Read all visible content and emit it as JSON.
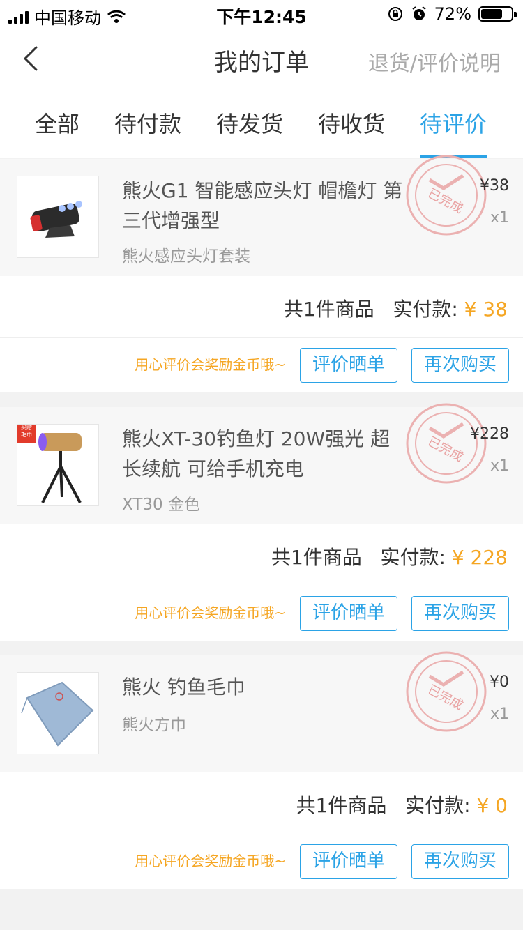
{
  "status_bar": {
    "carrier": "中国移动",
    "time": "下午12:45",
    "battery_pct": "72%",
    "battery_level": 0.72,
    "icons": [
      "signal-icon",
      "wifi-icon",
      "rotation-lock-icon",
      "alarm-icon",
      "battery-icon"
    ]
  },
  "nav": {
    "title": "我的订单",
    "right_link": "退货/评价说明",
    "back_icon": "chevron-left-icon"
  },
  "tabs": [
    {
      "label": "全部",
      "active": false
    },
    {
      "label": "待付款",
      "active": false
    },
    {
      "label": "待发货",
      "active": false
    },
    {
      "label": "待收货",
      "active": false
    },
    {
      "label": "待评价",
      "active": true
    }
  ],
  "stamp_text": "已完成",
  "orders": [
    {
      "name": "熊火G1 智能感应头灯 帽檐灯 第三代增强型",
      "spec": "熊火感应头灯套装",
      "price": "¥38",
      "qty": "x1",
      "count_text": "共1件商品",
      "paid_label": "实付款:",
      "paid_amount": "¥ 38",
      "tip": "用心评价会奖励金币哦~",
      "btn_review": "评价晒单",
      "btn_rebuy": "再次购买"
    },
    {
      "name": "熊火XT-30钓鱼灯 20W强光 超长续航 可给手机充电",
      "spec": "XT30 金色",
      "price": "¥228",
      "qty": "x1",
      "count_text": "共1件商品",
      "paid_label": "实付款:",
      "paid_amount": "¥ 228",
      "tip": "用心评价会奖励金币哦~",
      "btn_review": "评价晒单",
      "btn_rebuy": "再次购买",
      "badge": "买赠 毛巾"
    },
    {
      "name": "熊火 钓鱼毛巾",
      "spec": "熊火方巾",
      "price": "¥0",
      "qty": "x1",
      "count_text": "共1件商品",
      "paid_label": "实付款:",
      "paid_amount": "¥ 0",
      "tip": "用心评价会奖励金币哦~",
      "btn_review": "评价晒单",
      "btn_rebuy": "再次购买"
    }
  ],
  "colors": {
    "accent": "#2ba3e6",
    "price_orange": "#f5a623",
    "stamp_red": "#e9a2a2"
  }
}
